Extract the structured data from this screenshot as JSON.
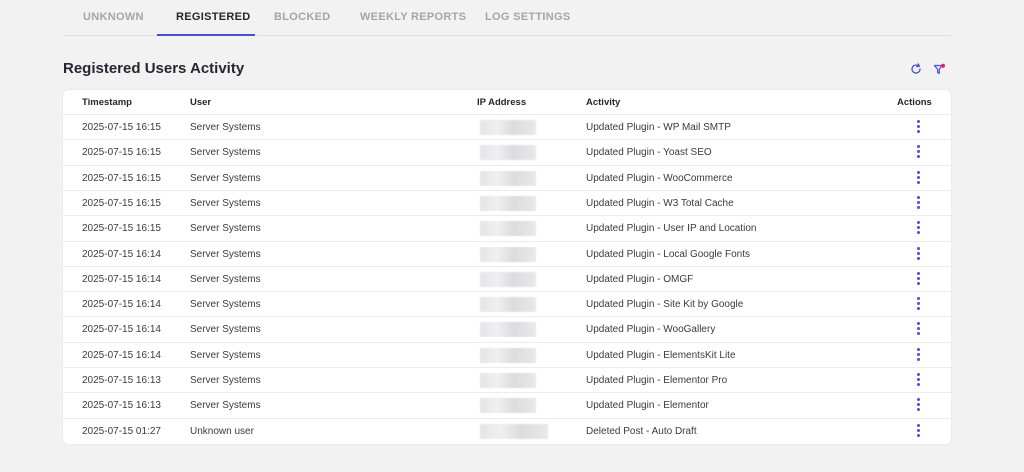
{
  "tabs": [
    {
      "label": "UNKNOWN",
      "active": false
    },
    {
      "label": "REGISTERED",
      "active": true
    },
    {
      "label": "BLOCKED",
      "active": false
    },
    {
      "label": "WEEKLY REPORTS",
      "active": false
    },
    {
      "label": "LOG SETTINGS",
      "active": false
    }
  ],
  "section_title": "Registered Users Activity",
  "toolbar": {
    "refresh_icon": "refresh-icon",
    "filter_icon": "filter-icon",
    "accent": "#4b4fd4",
    "filter_dot": "#e0245e"
  },
  "table": {
    "headers": {
      "timestamp": "Timestamp",
      "user": "User",
      "ip": "IP Address",
      "activity": "Activity",
      "actions": "Actions"
    },
    "rows": [
      {
        "timestamp": "2025-07-15 16:15",
        "user": "Server Systems",
        "activity": "Updated Plugin - WP Mail SMTP"
      },
      {
        "timestamp": "2025-07-15 16:15",
        "user": "Server Systems",
        "activity": "Updated Plugin - Yoast SEO"
      },
      {
        "timestamp": "2025-07-15 16:15",
        "user": "Server Systems",
        "activity": "Updated Plugin - WooCommerce"
      },
      {
        "timestamp": "2025-07-15 16:15",
        "user": "Server Systems",
        "activity": "Updated Plugin - W3 Total Cache"
      },
      {
        "timestamp": "2025-07-15 16:15",
        "user": "Server Systems",
        "activity": "Updated Plugin - User IP and Location"
      },
      {
        "timestamp": "2025-07-15 16:14",
        "user": "Server Systems",
        "activity": "Updated Plugin - Local Google Fonts"
      },
      {
        "timestamp": "2025-07-15 16:14",
        "user": "Server Systems",
        "activity": "Updated Plugin - OMGF"
      },
      {
        "timestamp": "2025-07-15 16:14",
        "user": "Server Systems",
        "activity": "Updated Plugin - Site Kit by Google"
      },
      {
        "timestamp": "2025-07-15 16:14",
        "user": "Server Systems",
        "activity": "Updated Plugin - WooGallery"
      },
      {
        "timestamp": "2025-07-15 16:14",
        "user": "Server Systems",
        "activity": "Updated Plugin - ElementsKit Lite"
      },
      {
        "timestamp": "2025-07-15 16:13",
        "user": "Server Systems",
        "activity": "Updated Plugin - Elementor Pro"
      },
      {
        "timestamp": "2025-07-15 16:13",
        "user": "Server Systems",
        "activity": "Updated Plugin - Elementor"
      },
      {
        "timestamp": "2025-07-15 01:27",
        "user": "Unknown user",
        "activity": "Deleted Post - Auto Draft"
      }
    ]
  }
}
